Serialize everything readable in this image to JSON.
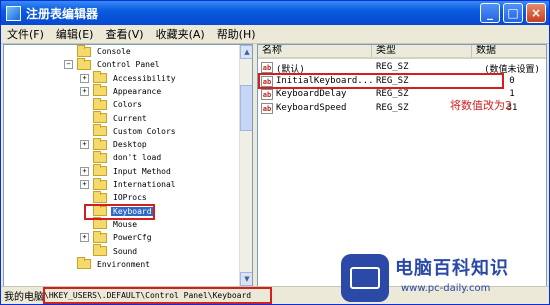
{
  "window": {
    "title": "注册表编辑器",
    "minimize": "_",
    "maximize": "□",
    "close": "×"
  },
  "menu": [
    "文件(F)",
    "编辑(E)",
    "查看(V)",
    "收藏夹(A)",
    "帮助(H)"
  ],
  "tree": {
    "items": [
      {
        "label": "Console",
        "expander": ""
      },
      {
        "label": "Control Panel",
        "expander": "−"
      },
      {
        "label": "Accessibility",
        "expander": "+"
      },
      {
        "label": "Appearance",
        "expander": "+"
      },
      {
        "label": "Colors",
        "expander": ""
      },
      {
        "label": "Current",
        "expander": ""
      },
      {
        "label": "Custom Colors",
        "expander": ""
      },
      {
        "label": "Desktop",
        "expander": "+"
      },
      {
        "label": "don't load",
        "expander": ""
      },
      {
        "label": "Input Method",
        "expander": "+"
      },
      {
        "label": "International",
        "expander": "+"
      },
      {
        "label": "IOProcs",
        "expander": ""
      },
      {
        "label": "Keyboard",
        "expander": "",
        "selected": true
      },
      {
        "label": "Mouse",
        "expander": ""
      },
      {
        "label": "PowerCfg",
        "expander": "+"
      },
      {
        "label": "Sound",
        "expander": ""
      },
      {
        "label": "Environment",
        "expander": ""
      }
    ]
  },
  "columns": {
    "name": "名称",
    "type": "类型",
    "data": "数据"
  },
  "values": [
    {
      "name": "(默认)",
      "type": "REG_SZ",
      "data": "(数值未设置)"
    },
    {
      "name": "InitialKeyboard...",
      "type": "REG_SZ",
      "data": "0"
    },
    {
      "name": "KeyboardDelay",
      "type": "REG_SZ",
      "data": "1"
    },
    {
      "name": "KeyboardSpeed",
      "type": "REG_SZ",
      "data": "31"
    }
  ],
  "value_icon": "ab",
  "annotation": "将数值改为2",
  "status": {
    "prefix": "我的电脑",
    "path": "\\HKEY_USERS\\.DEFAULT\\Control Panel\\Keyboard"
  },
  "watermark": {
    "name": "电脑百科知识",
    "url": "www.pc-daily.com"
  },
  "colors": {
    "highlight": "#D21F1F",
    "selection": "#316AC5",
    "title_bar": "#0A5BE0"
  }
}
